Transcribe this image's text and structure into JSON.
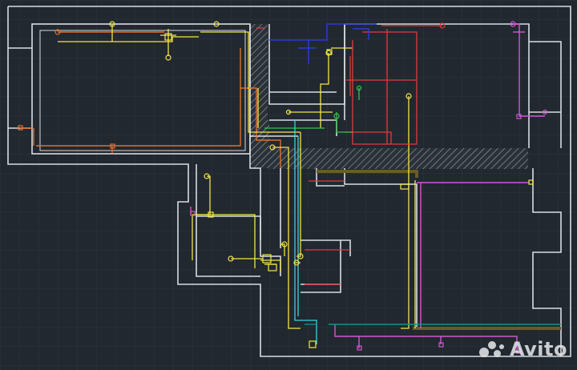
{
  "watermark": {
    "text": "Avito"
  },
  "colors": {
    "background": "#212830",
    "grid": "#2b333c",
    "walls": "#d9dde2",
    "yellow": "#f5e54a",
    "orange": "#e0702a",
    "red": "#e23b3b",
    "blue": "#2a3bd6",
    "magenta": "#d455d4",
    "green": "#36c24a",
    "cyan": "#3fd0e0",
    "teal": "#1f8a8a",
    "brown": "#6b5a2a"
  },
  "layers": [
    "walls",
    "hatch",
    "yellow-wiring",
    "orange-wiring",
    "red-wiring",
    "blue-wiring",
    "magenta-wiring",
    "green-wiring",
    "cyan-wiring"
  ]
}
